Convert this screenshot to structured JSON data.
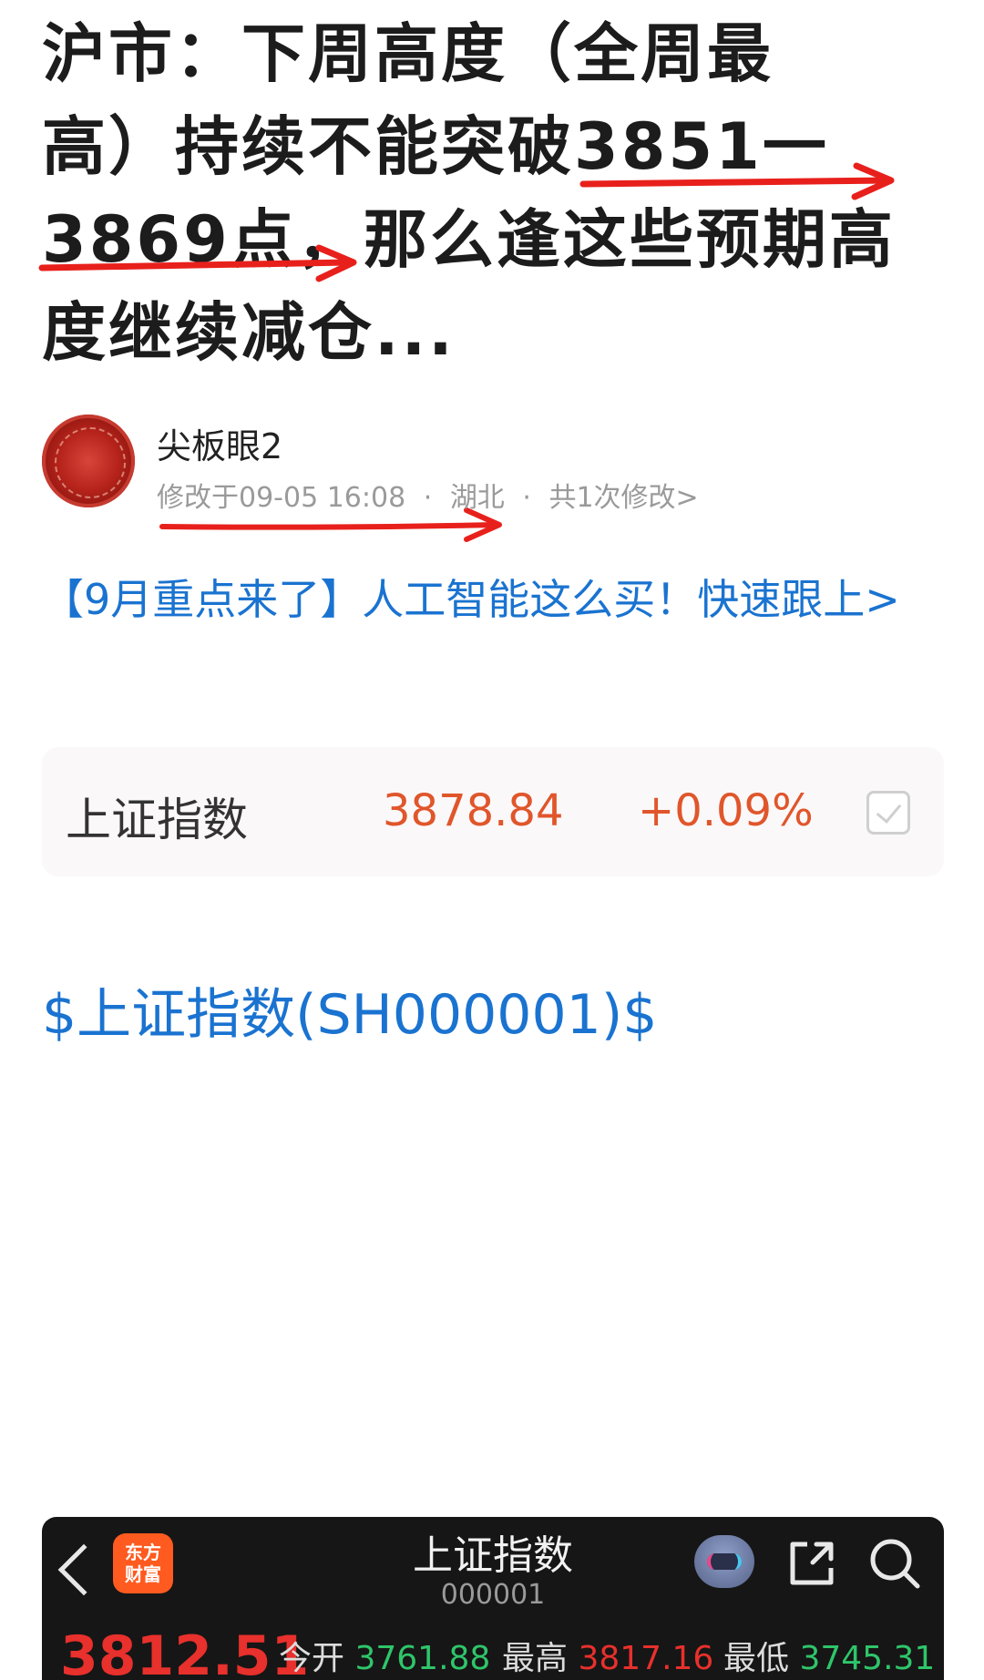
{
  "article": {
    "title_line1": "沪市：下周高度（全周最",
    "title_line2": "高）持续不能突破3851一",
    "title_line3": "3869点，那么逢这些预期高",
    "title_line4": "度继续减仓..."
  },
  "author": {
    "name": "尖板眼2",
    "modified": "修改于09-05 16:08",
    "location": "湖北",
    "edits": "共1次修改>",
    "separator": "·"
  },
  "promo": {
    "text": "【9月重点来了】人工智能这么买！快速跟上>"
  },
  "quote": {
    "name": "上证指数",
    "price": "3878.84",
    "change": "+0.09%"
  },
  "stock_tag": "$上证指数(SH000001)$",
  "app": {
    "logo_line1": "东方",
    "logo_line2": "财富",
    "title": "上证指数",
    "code": "000001",
    "price": "3812.51",
    "open_label": "今开",
    "open_value": "3761.88",
    "high_label": "最高",
    "high_value": "3817.16",
    "low_label": "最低",
    "low_value": "3745.31"
  },
  "colors": {
    "link_blue": "#1a73d0",
    "quote_orange": "#e0562b",
    "annotation_red": "#e8201c",
    "up_red": "#e8302c",
    "down_green": "#2fc56a"
  }
}
